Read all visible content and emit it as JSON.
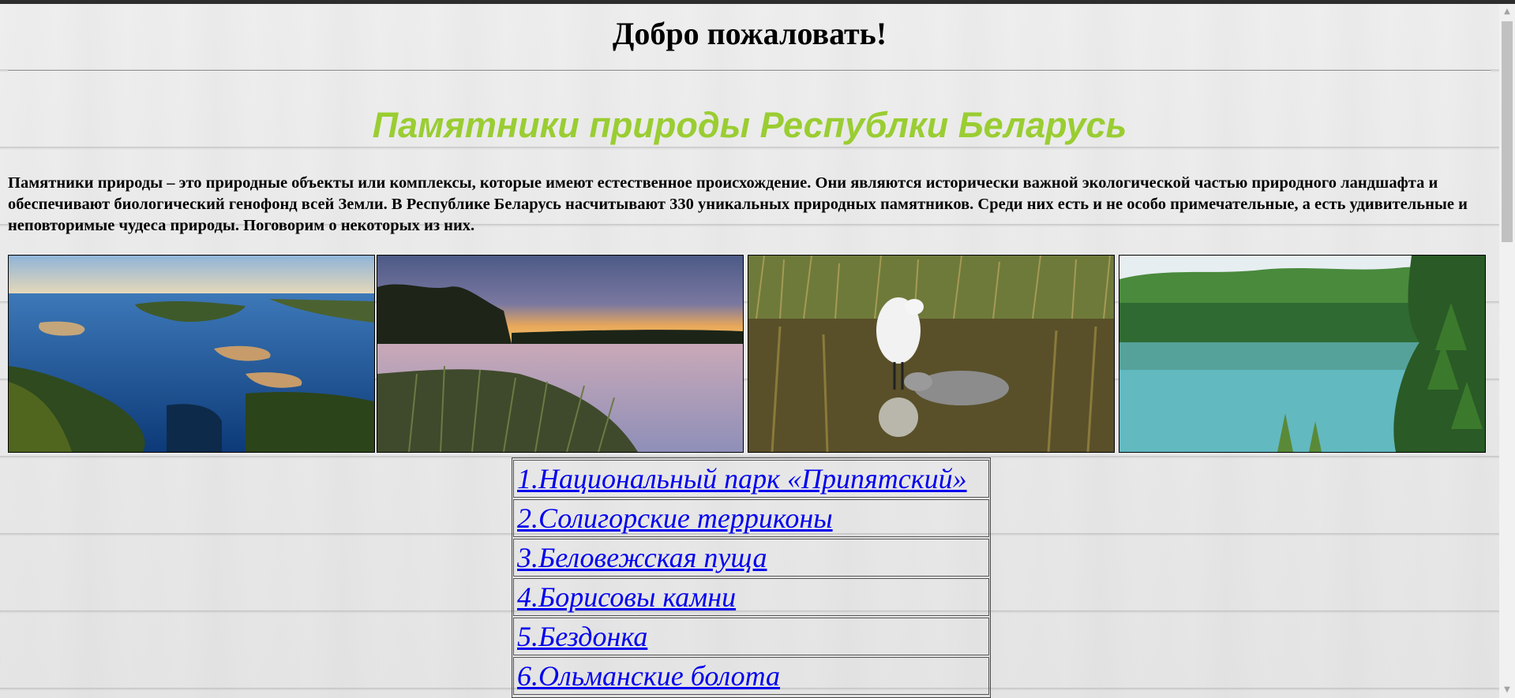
{
  "header": {
    "welcome": "Добро пожаловать!",
    "title": "Памятники природы Республки Беларусь"
  },
  "intro": {
    "text": "Памятники природы – это природные объекты или комплексы, которые имеют естественное происхождение. Они являются исторически важной экологической частью природного ландшафта и обеспечивают биологический генофонд всей Земли. В Республике Беларусь насчитывают 330 уникальных природных памятников. Среди них есть и не особо примечательные, а есть удивительные и неповторимые чудеса природы. Поговорим о некоторых из них."
  },
  "gallery": {
    "images": [
      "lake-aerial-image",
      "sunset-lake-image",
      "heron-swan-image",
      "turquoise-lake-image"
    ]
  },
  "nav": {
    "items": [
      {
        "label": "1.Национальный парк «Припятский»"
      },
      {
        "label": "2.Солигорские терриконы"
      },
      {
        "label": "3.Беловежская пуща"
      },
      {
        "label": "4.Борисовы камни"
      },
      {
        "label": "5.Бездонка"
      },
      {
        "label": "6.Ольманские болота"
      }
    ]
  },
  "colors": {
    "title": "#9acd32",
    "link": "#0000ee",
    "background": "#e8e8e8"
  }
}
